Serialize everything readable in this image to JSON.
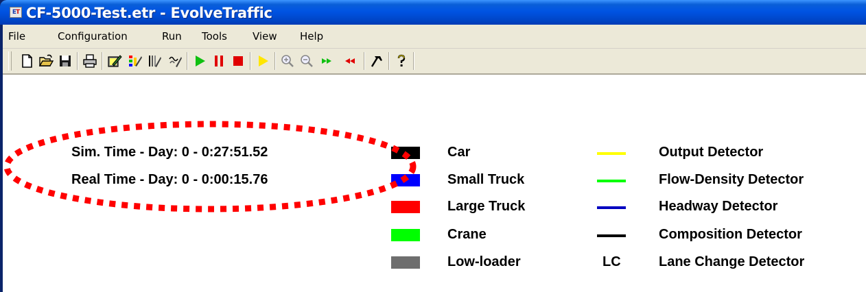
{
  "window": {
    "title": "CF-5000-Test.etr - EvolveTraffic",
    "icon_text": "ET"
  },
  "menu": [
    "File",
    "Configuration",
    "Run",
    "Tools",
    "View",
    "Help"
  ],
  "toolbar": {
    "buttons": [
      "new-document-icon",
      "open-folder-icon",
      "save-icon",
      "print-icon",
      "edit-network-icon",
      "edit-vehicles-icon",
      "edit-detectors-icon",
      "edit-routes-icon",
      "run-icon",
      "pause-icon",
      "stop-icon",
      "step-icon",
      "zoom-in-icon",
      "zoom-out-icon",
      "speed-up-icon",
      "slow-down-icon",
      "tools-icon",
      "help-icon"
    ]
  },
  "status": {
    "sim_time": "Sim. Time - Day: 0 - 0:27:51.52",
    "real_time": "Real Time - Day: 0 - 0:00:15.76"
  },
  "vehicle_legend": [
    {
      "label": "Car",
      "color": "#000000"
    },
    {
      "label": "Small Truck",
      "color": "#0000ff"
    },
    {
      "label": "Large Truck",
      "color": "#ff0000"
    },
    {
      "label": "Crane",
      "color": "#00ff00"
    },
    {
      "label": "Low-loader",
      "color": "#6e6e6e"
    }
  ],
  "detector_legend": [
    {
      "label": "Output Detector",
      "color": "#ffff00"
    },
    {
      "label": "Flow-Density Detector",
      "color": "#00ff00"
    },
    {
      "label": "Headway Detector",
      "color": "#0000c0"
    },
    {
      "label": "Composition Detector",
      "color": "#000000"
    },
    {
      "label": "Lane Change Detector",
      "symbol": "LC"
    }
  ],
  "annotation_color": "#ff0000"
}
